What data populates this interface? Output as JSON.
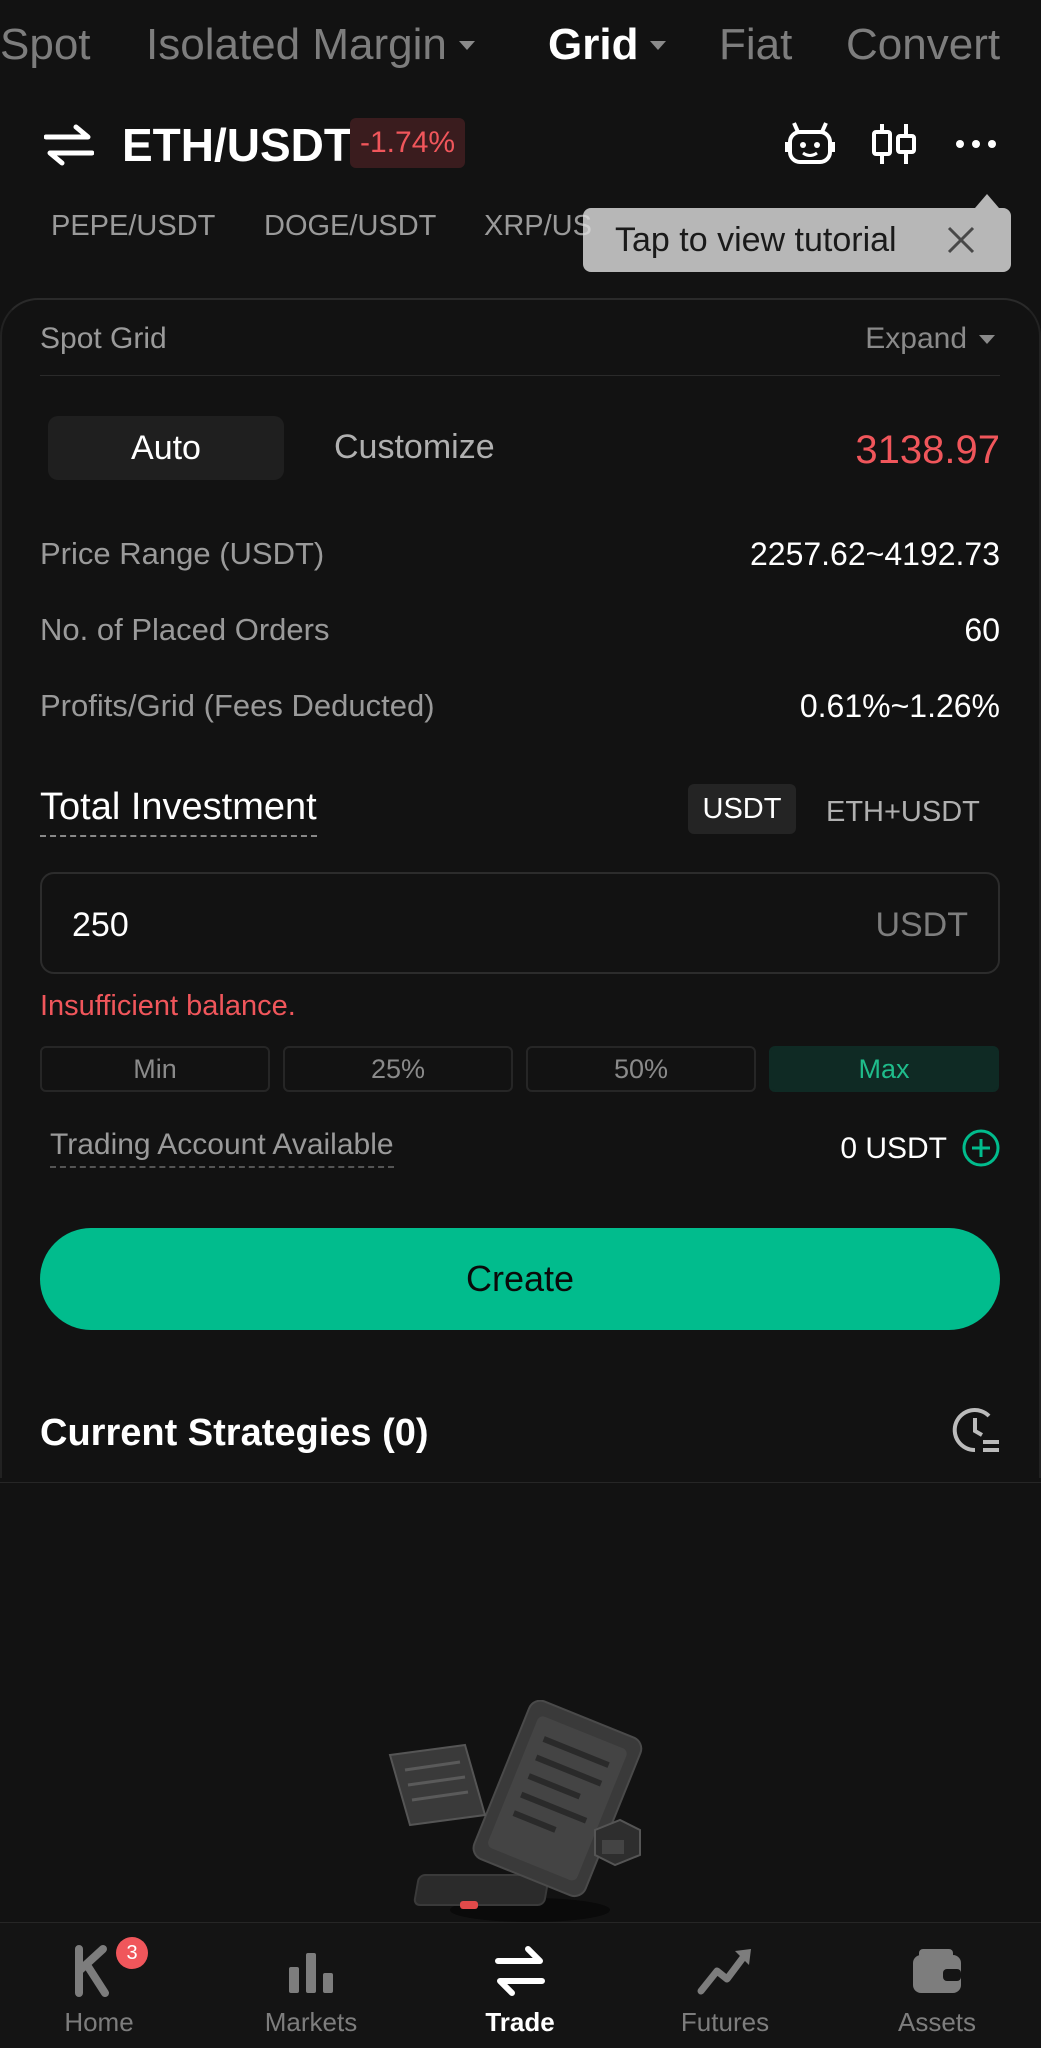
{
  "top_tabs": {
    "spot": "Spot",
    "isolated_margin": "Isolated Margin",
    "grid": "Grid",
    "fiat": "Fiat",
    "convert": "Convert"
  },
  "pair": {
    "name": "ETH/USDT",
    "change": "-1.74%"
  },
  "pair_tabs": [
    "PEPE/USDT",
    "DOGE/USDT",
    "XRP/US"
  ],
  "tooltip": {
    "text": "Tap to view tutorial"
  },
  "strategy": {
    "title": "Spot Grid",
    "expand": "Expand",
    "mode_auto": "Auto",
    "mode_customize": "Customize",
    "current_price": "3138.97"
  },
  "params": [
    {
      "label": "Price Range (USDT)",
      "value": "2257.62~4192.73"
    },
    {
      "label": "No. of Placed Orders",
      "value": "60"
    },
    {
      "label": "Profits/Grid (Fees Deducted)",
      "value": "0.61%~1.26%"
    }
  ],
  "investment": {
    "title": "Total Investment",
    "currency_usdt": "USDT",
    "currency_eth_usdt": "ETH+USDT",
    "amount": "250",
    "unit": "USDT",
    "error": "Insufficient balance.",
    "pct": [
      "Min",
      "25%",
      "50%",
      "Max"
    ],
    "available_label": "Trading Account Available",
    "available_value": "0 USDT"
  },
  "create_label": "Create",
  "current_strategies": "Current Strategies (0)",
  "nav": {
    "home": "Home",
    "home_badge": "3",
    "markets": "Markets",
    "trade": "Trade",
    "futures": "Futures",
    "assets": "Assets"
  },
  "colors": {
    "accent_green": "#01bc8d",
    "negative_red": "#f0565b",
    "background": "#121212"
  }
}
